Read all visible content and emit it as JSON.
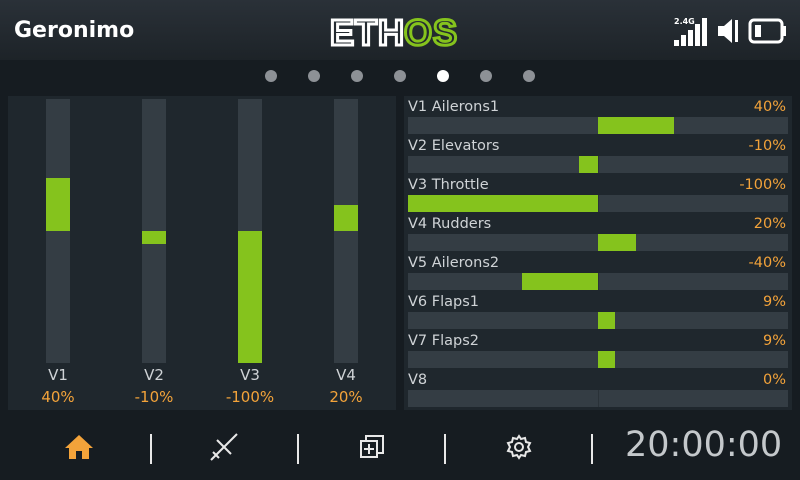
{
  "header": {
    "model_name": "Geronimo",
    "logo_text": "ETHOS",
    "band_label": "2.4G"
  },
  "page_dots": {
    "count": 7,
    "active_index": 4
  },
  "colors": {
    "fill": "#85c31d",
    "value_text": "#f3a33a",
    "logo_green": "#85c31d",
    "home_icon": "#f3a33a"
  },
  "vertical_bars": [
    {
      "label": "V1",
      "value_text": "40%",
      "value": 40
    },
    {
      "label": "V2",
      "value_text": "-10%",
      "value": -10
    },
    {
      "label": "V3",
      "value_text": "-100%",
      "value": -100
    },
    {
      "label": "V4",
      "value_text": "20%",
      "value": 20
    }
  ],
  "horizontal_bars": [
    {
      "label": "V1 Ailerons1",
      "value_text": "40%",
      "value": 40
    },
    {
      "label": "V2 Elevators",
      "value_text": "-10%",
      "value": -10
    },
    {
      "label": "V3 Throttle",
      "value_text": "-100%",
      "value": -100
    },
    {
      "label": "V4 Rudders",
      "value_text": "20%",
      "value": 20
    },
    {
      "label": "V5 Ailerons2",
      "value_text": "-40%",
      "value": -40
    },
    {
      "label": "V6 Flaps1",
      "value_text": "9%",
      "value": 9
    },
    {
      "label": "V7 Flaps2",
      "value_text": "9%",
      "value": 9
    },
    {
      "label": "V8",
      "value_text": "0%",
      "value": 0
    }
  ],
  "footer": {
    "icons": [
      "home-icon",
      "model-icon",
      "system-icon",
      "settings-icon"
    ],
    "clock": "20:00:00"
  }
}
